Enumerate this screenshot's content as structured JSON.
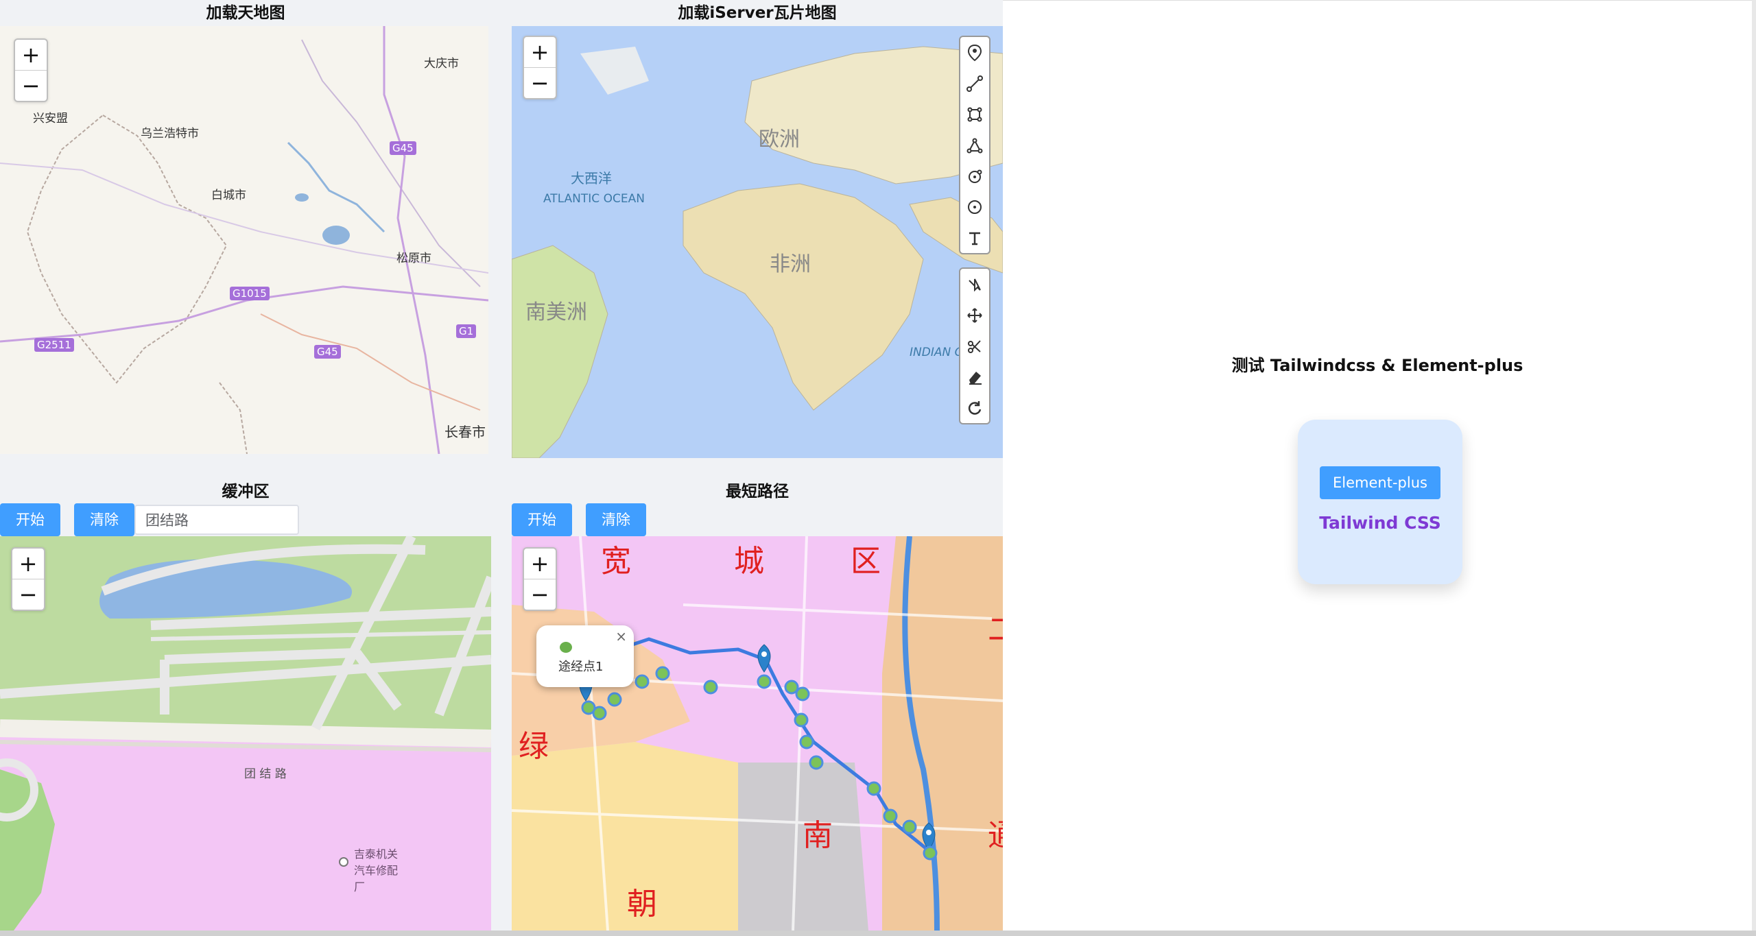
{
  "panels": {
    "tianditu": {
      "title": "加载天地图",
      "labels": [
        "大庆市",
        "兴安盟",
        "乌兰浩特市",
        "白城市",
        "松原市",
        "长春市"
      ],
      "highways": [
        "G45",
        "G1015",
        "G2511",
        "G45",
        "G1"
      ]
    },
    "iserver": {
      "title": "加载iServer瓦片地图",
      "labels": {
        "europe": "欧洲",
        "atlantic_cn": "大西洋",
        "atlantic_en": "ATLANTIC OCEAN",
        "africa": "非洲",
        "south_america": "南美洲",
        "indian_en": "INDIAN O"
      },
      "draw_tools": [
        "marker-icon",
        "polyline-icon",
        "rectangle-icon",
        "polygon-icon",
        "circle-marker-icon",
        "circle-icon",
        "text-icon"
      ],
      "edit_tools": [
        "cut-icon",
        "move-icon",
        "scissors-icon",
        "eraser-icon",
        "rotate-icon"
      ]
    },
    "buffer": {
      "title": "缓冲区",
      "start_label": "开始",
      "clear_label": "清除",
      "input_value": "团结路",
      "road_label": "团 结 路",
      "poi_label": "吉泰机关汽车修配厂"
    },
    "route": {
      "title": "最短路径",
      "start_label": "开始",
      "clear_label": "清除",
      "popup_text": "途经点1",
      "district_labels": [
        "宽",
        "城",
        "区",
        "绿",
        "南",
        "朝",
        "二",
        "通"
      ]
    },
    "showcase": {
      "title": "测试 Tailwindcss & Element-plus",
      "element_button": "Element-plus",
      "tailwind_text": "Tailwind CSS"
    }
  },
  "zoom": {
    "plus": "+",
    "minus": "−"
  },
  "colors": {
    "primary": "#409eff",
    "tailwind_purple": "#7e3ad4",
    "card_bg": "#dbeafe"
  }
}
